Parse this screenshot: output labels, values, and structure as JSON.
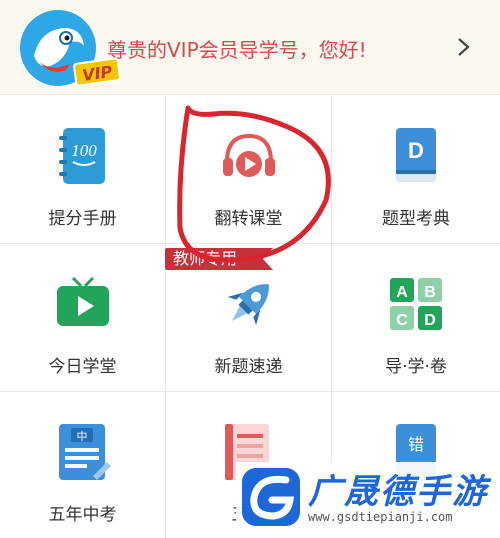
{
  "header": {
    "greeting": "尊贵的VIP会员导学号，您好!",
    "vip_badge": "VIP",
    "avatar_icon": "bird-mascot-icon",
    "chevron_icon": "chevron-right-icon"
  },
  "grid": {
    "items": [
      {
        "label": "提分手册",
        "icon": "notebook-100-icon"
      },
      {
        "label": "翻转课堂",
        "icon": "headphones-play-icon"
      },
      {
        "label": "题型考典",
        "icon": "dictionary-d-icon"
      },
      {
        "label": "今日学堂",
        "icon": "tv-play-icon"
      },
      {
        "label": "新题速递",
        "icon": "rocket-icon"
      },
      {
        "label": "导·学·卷",
        "icon": "abcd-tiles-icon"
      },
      {
        "label": "五年中考",
        "icon": "exam-paper-icon"
      },
      {
        "label": "五年",
        "icon": "document-icon"
      },
      {
        "label": "",
        "icon": "error-book-icon"
      }
    ],
    "teacher_only": "教师专用"
  },
  "watermark": {
    "title": "广晟德手游",
    "url": "www.gsdtiepianji.com"
  },
  "colors": {
    "accent_red": "#d9484e",
    "ribbon_red": "#c8313a",
    "teal": "#2e9bd6",
    "green": "#22a55a"
  }
}
